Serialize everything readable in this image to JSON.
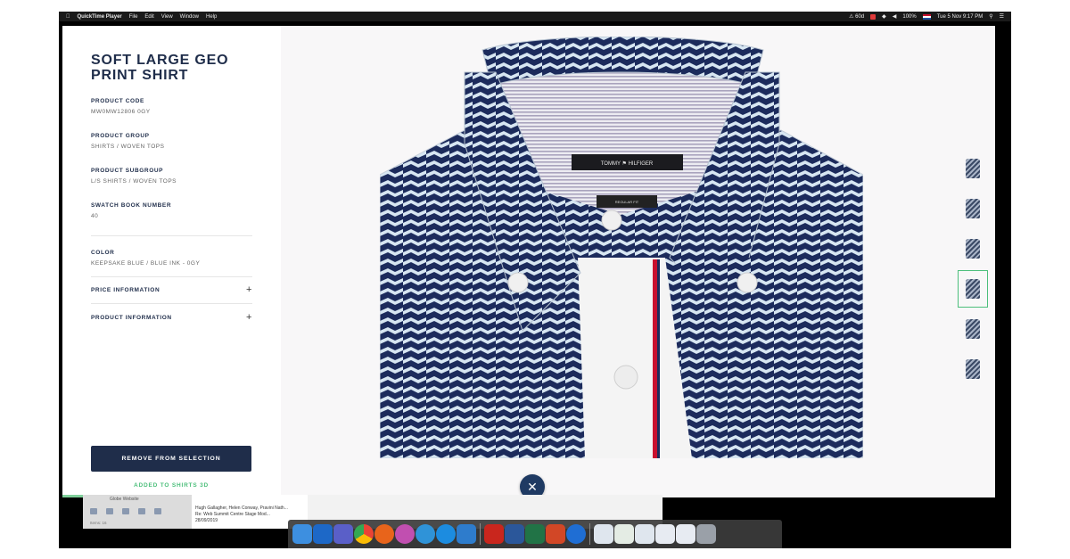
{
  "menubar": {
    "apple": "",
    "items": [
      "QuickTime Player",
      "File",
      "Edit",
      "View",
      "Window",
      "Help"
    ],
    "status": {
      "alert": "⚠ 60d",
      "battery": "100%",
      "datetime": "Tue 5 Nov  9:17 PM"
    }
  },
  "product": {
    "title": "SOFT LARGE GEO PRINT SHIRT",
    "specs": [
      {
        "label": "PRODUCT CODE",
        "value": "MW0MW12806 0GY"
      },
      {
        "label": "PRODUCT GROUP",
        "value": "SHIRTS / WOVEN TOPS"
      },
      {
        "label": "PRODUCT SUBGROUP",
        "value": "L/S SHIRTS / WOVEN TOPS"
      },
      {
        "label": "SWATCH BOOK NUMBER",
        "value": "40"
      }
    ],
    "color": {
      "label": "COLOR",
      "value": "KEEPSAKE BLUE / BLUE INK - 0GY"
    },
    "accordions": [
      {
        "label": "PRICE INFORMATION",
        "icon": "+"
      },
      {
        "label": "PRODUCT INFORMATION",
        "icon": "+"
      }
    ],
    "remove_button": "REMOVE FROM SELECTION",
    "added_text": "ADDED TO SHIRTS 3D",
    "brand_tag": "TOMMY ⚑ HILFIGER",
    "fit_tag": "REGULAR FIT"
  },
  "thumbnails": [
    {
      "name": "front-view",
      "active": false
    },
    {
      "name": "back-view",
      "active": false
    },
    {
      "name": "folded-view",
      "active": false
    },
    {
      "name": "collar-view",
      "active": true
    },
    {
      "name": "detail-view",
      "active": false
    },
    {
      "name": "packaged-view",
      "active": false
    }
  ],
  "close_icon": "✕",
  "mail": {
    "folder": "Globe Website",
    "line1": "Hugh Gallagher, Helen Conway, Pravini Nath...",
    "line2": "Re: Web Summit Centre Stage Mod...",
    "date": "28/09/2019",
    "status": "Items: 16"
  },
  "colors": {
    "navy": "#1f2d4a",
    "accent_green": "#4cbf7b",
    "shirt_blue": "#1c2b5c",
    "shirt_light": "#d7e6f2"
  }
}
